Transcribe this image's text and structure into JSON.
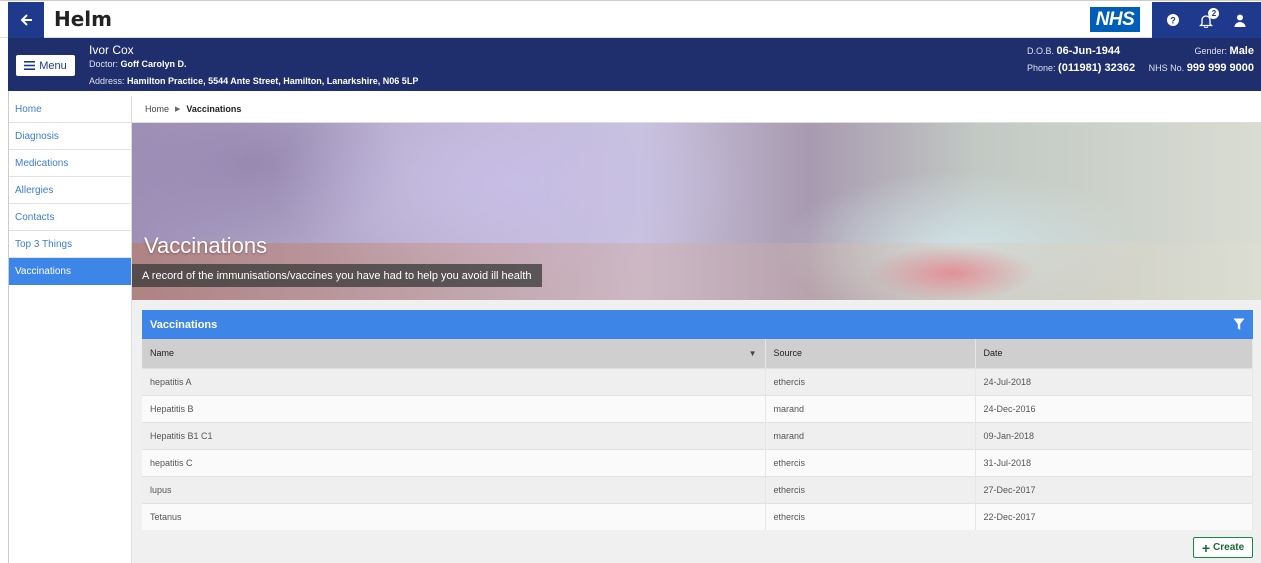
{
  "app": {
    "title": "Helm",
    "logo_text": "NHS",
    "notification_count": "2"
  },
  "patient": {
    "menu_label": "Menu",
    "name": "Ivor Cox",
    "doctor_label": "Doctor:",
    "doctor": "Goff Carolyn D.",
    "address_label": "Address:",
    "address": "Hamilton Practice, 5544 Ante Street, Hamilton, Lanarkshire, N06 5LP",
    "dob_label": "D.O.B.",
    "dob": "06-Jun-1944",
    "phone_label": "Phone:",
    "phone": "(011981) 32362",
    "gender_label": "Gender:",
    "gender": "Male",
    "nhs_label": "NHS No.",
    "nhs_no": "999 999 9000"
  },
  "sidebar": {
    "items": [
      {
        "label": "Home"
      },
      {
        "label": "Diagnosis"
      },
      {
        "label": "Medications"
      },
      {
        "label": "Allergies"
      },
      {
        "label": "Contacts"
      },
      {
        "label": "Top 3 Things"
      },
      {
        "label": "Vaccinations"
      }
    ],
    "active_index": 6
  },
  "breadcrumb": {
    "home": "Home",
    "current": "Vaccinations"
  },
  "hero": {
    "title": "Vaccinations",
    "subtitle": "A record of the immunisations/vaccines you have had to help you avoid ill health"
  },
  "panel": {
    "title": "Vaccinations",
    "columns": [
      "Name",
      "Source",
      "Date"
    ],
    "rows": [
      {
        "name": "hepatitis A",
        "source": "ethercis",
        "date": "24-Jul-2018"
      },
      {
        "name": "Hepatitis B",
        "source": "marand",
        "date": "24-Dec-2016"
      },
      {
        "name": "Hepatitis B1 C1",
        "source": "marand",
        "date": "09-Jan-2018"
      },
      {
        "name": "hepatitis C",
        "source": "ethercis",
        "date": "31-Jul-2018"
      },
      {
        "name": "lupus",
        "source": "ethercis",
        "date": "27-Dec-2017"
      },
      {
        "name": "Tetanus",
        "source": "ethercis",
        "date": "22-Dec-2017"
      }
    ],
    "create_label": "Create"
  },
  "colors": {
    "brand_navy": "#1f2f6e",
    "nav_blue": "#1f3a8c",
    "accent_blue": "#3d86e8",
    "nhs_blue": "#005eb8",
    "create_green": "#1a8a3a"
  }
}
